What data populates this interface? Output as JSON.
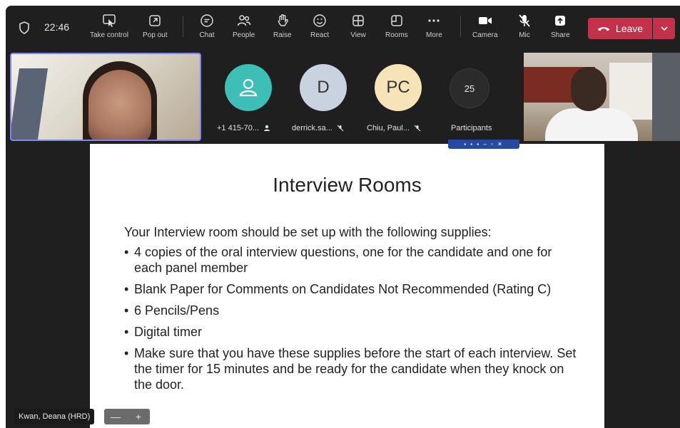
{
  "toolbar": {
    "time": "22:46",
    "buttons": {
      "take_control": "Take control",
      "pop_out": "Pop out",
      "chat": "Chat",
      "people": "People",
      "raise": "Raise",
      "react": "React",
      "view": "View",
      "rooms": "Rooms",
      "more": "More",
      "camera": "Camera",
      "mic": "Mic",
      "share": "Share"
    },
    "leave_label": "Leave"
  },
  "participants": {
    "tiles": [
      {
        "initials": "",
        "label": "+1 415-70...",
        "color": "#3dbeb6"
      },
      {
        "initials": "D",
        "label": "derrick.sa...",
        "color": "#c9d3df"
      },
      {
        "initials": "PC",
        "label": "Chiu, Paul...",
        "color": "#f6e3b8"
      }
    ],
    "count": "25",
    "count_label": "Participants"
  },
  "slide": {
    "title": "Interview Rooms",
    "intro": "Your Interview room should be set up with the following supplies:",
    "bullets": [
      "4 copies of the oral interview questions, one for the candidate and one for each panel member",
      "Blank Paper for Comments on Candidates Not Recommended (Rating C)",
      "6 Pencils/Pens",
      "Digital timer",
      "Make sure that you have these supplies before the start of each interview. Set the timer for 15 minutes and be ready for the candidate when they knock on the door."
    ]
  },
  "presenter_name": "Kwan, Deana (HRD)",
  "zoom": {
    "minus": "—",
    "plus": "+"
  },
  "colors": {
    "leave": "#c4314b",
    "accent": "#7f85f5",
    "share_bar": "#264b9e"
  }
}
